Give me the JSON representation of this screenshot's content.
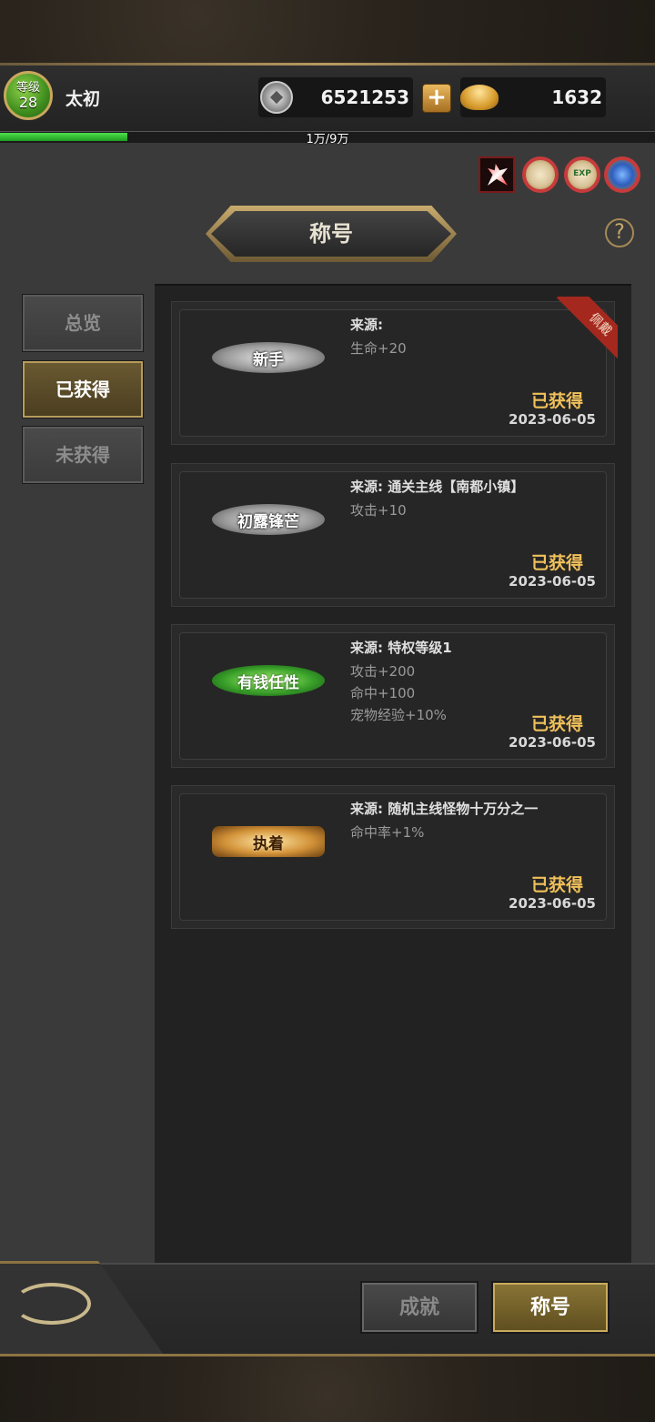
{
  "header": {
    "level_label": "等级",
    "level": "28",
    "player_name": "太初",
    "silver": "6521253",
    "gold": "1632",
    "xp_text": "1万/9万",
    "xp_fraction": 0.1944
  },
  "buffs": [
    {
      "icon": "red-burst-icon"
    },
    {
      "icon": "medal-icon"
    },
    {
      "icon": "exp-medal-icon",
      "label": "EXP"
    },
    {
      "icon": "blue-gem-medal-icon"
    }
  ],
  "page": {
    "title": "称号",
    "help": "?"
  },
  "side_tabs": [
    "总览",
    "已获得",
    "未获得"
  ],
  "cards": [
    {
      "badge": "新手",
      "source": "来源:",
      "attrs": [
        "生命+20"
      ],
      "status": "已获得",
      "date": "2023-06-05",
      "equipped_label": "佩戴"
    },
    {
      "badge": "初露锋芒",
      "source": "来源: 通关主线【南都小镇】",
      "attrs": [
        "攻击+10"
      ],
      "status": "已获得",
      "date": "2023-06-05"
    },
    {
      "badge": "有钱任性",
      "source": "来源: 特权等级1",
      "attrs": [
        "攻击+200",
        "命中+100",
        "宠物经验+10%"
      ],
      "status": "已获得",
      "date": "2023-06-05"
    },
    {
      "badge": "执着",
      "source": "来源: 随机主线怪物十万分之一",
      "attrs": [
        "命中率+1%"
      ],
      "status": "已获得",
      "date": "2023-06-05"
    }
  ],
  "bottom": {
    "achievement_label": "成就",
    "title_label": "称号"
  }
}
